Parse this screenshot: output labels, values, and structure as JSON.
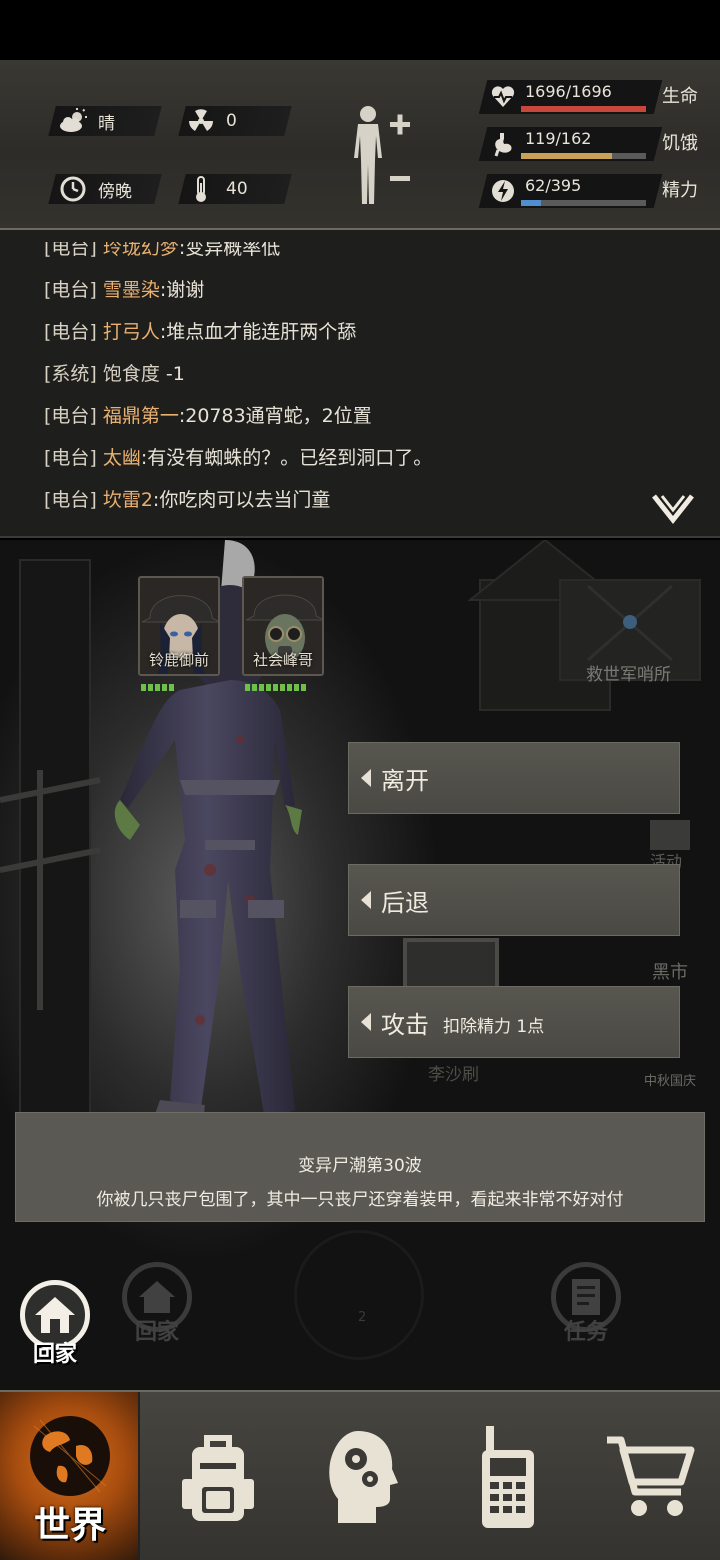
{
  "status": {
    "weather": "晴",
    "radiation": "0",
    "time_of_day": "傍晚",
    "temperature": "40"
  },
  "stats": [
    {
      "value": "1696/1696",
      "name": "生命",
      "fill": 1.0,
      "color": "#c8473c",
      "icon": "heart-pulse-icon"
    },
    {
      "value": "119/162",
      "name": "饥饿",
      "fill": 0.73,
      "color": "#c8a056",
      "icon": "stomach-icon"
    },
    {
      "value": "62/395",
      "name": "精力",
      "fill": 0.16,
      "color": "#4f8fcf",
      "icon": "energy-bolt-icon"
    }
  ],
  "chat": {
    "lines": [
      {
        "tag": "[电台]",
        "who": "玲珑幻梦",
        "msg": ":变异概率低"
      },
      {
        "tag": "[电台]",
        "who": "雪墨染",
        "msg": ":谢谢"
      },
      {
        "tag": "[电台]",
        "who": "打弓人",
        "msg": ":堆点血才能连肝两个舔"
      },
      {
        "tag": "[系统]",
        "who": "饱食度",
        "msg": " -1"
      },
      {
        "tag": "[电台]",
        "who": "福鼎第一",
        "msg": ":20783通宵蛇，2位置"
      },
      {
        "tag": "[电台]",
        "who": "太幽",
        "msg": ":有没有蜘蛛的？。已经到洞口了。"
      },
      {
        "tag": "[电台]",
        "who": "坎雷2",
        "msg": ":你吃肉可以去当门童"
      }
    ]
  },
  "scene": {
    "background_labels": {
      "outpost": "救世军哨所",
      "activity": "活动",
      "black_market": "黑市",
      "festival": "中秋国庆",
      "li_shasha": "李沙刷"
    },
    "party": [
      {
        "name": "铃鹿御前",
        "hp_dots": 5
      },
      {
        "name": "社会峰哥",
        "hp_dots": 9
      }
    ],
    "actions": {
      "leave": "离开",
      "retreat": "后退",
      "attack": "攻击",
      "attack_cost": "扣除精力 1点"
    },
    "event": {
      "title": "变异尸潮第30波",
      "description": "你被几只丧尸包围了，其中一只丧尸还穿着装甲，看起来非常不好对付"
    },
    "shortcuts": {
      "home": "回家",
      "home_faded": "回家",
      "task_faded": "任务",
      "page_indicator": "2"
    }
  },
  "nav": {
    "world": "世界"
  }
}
